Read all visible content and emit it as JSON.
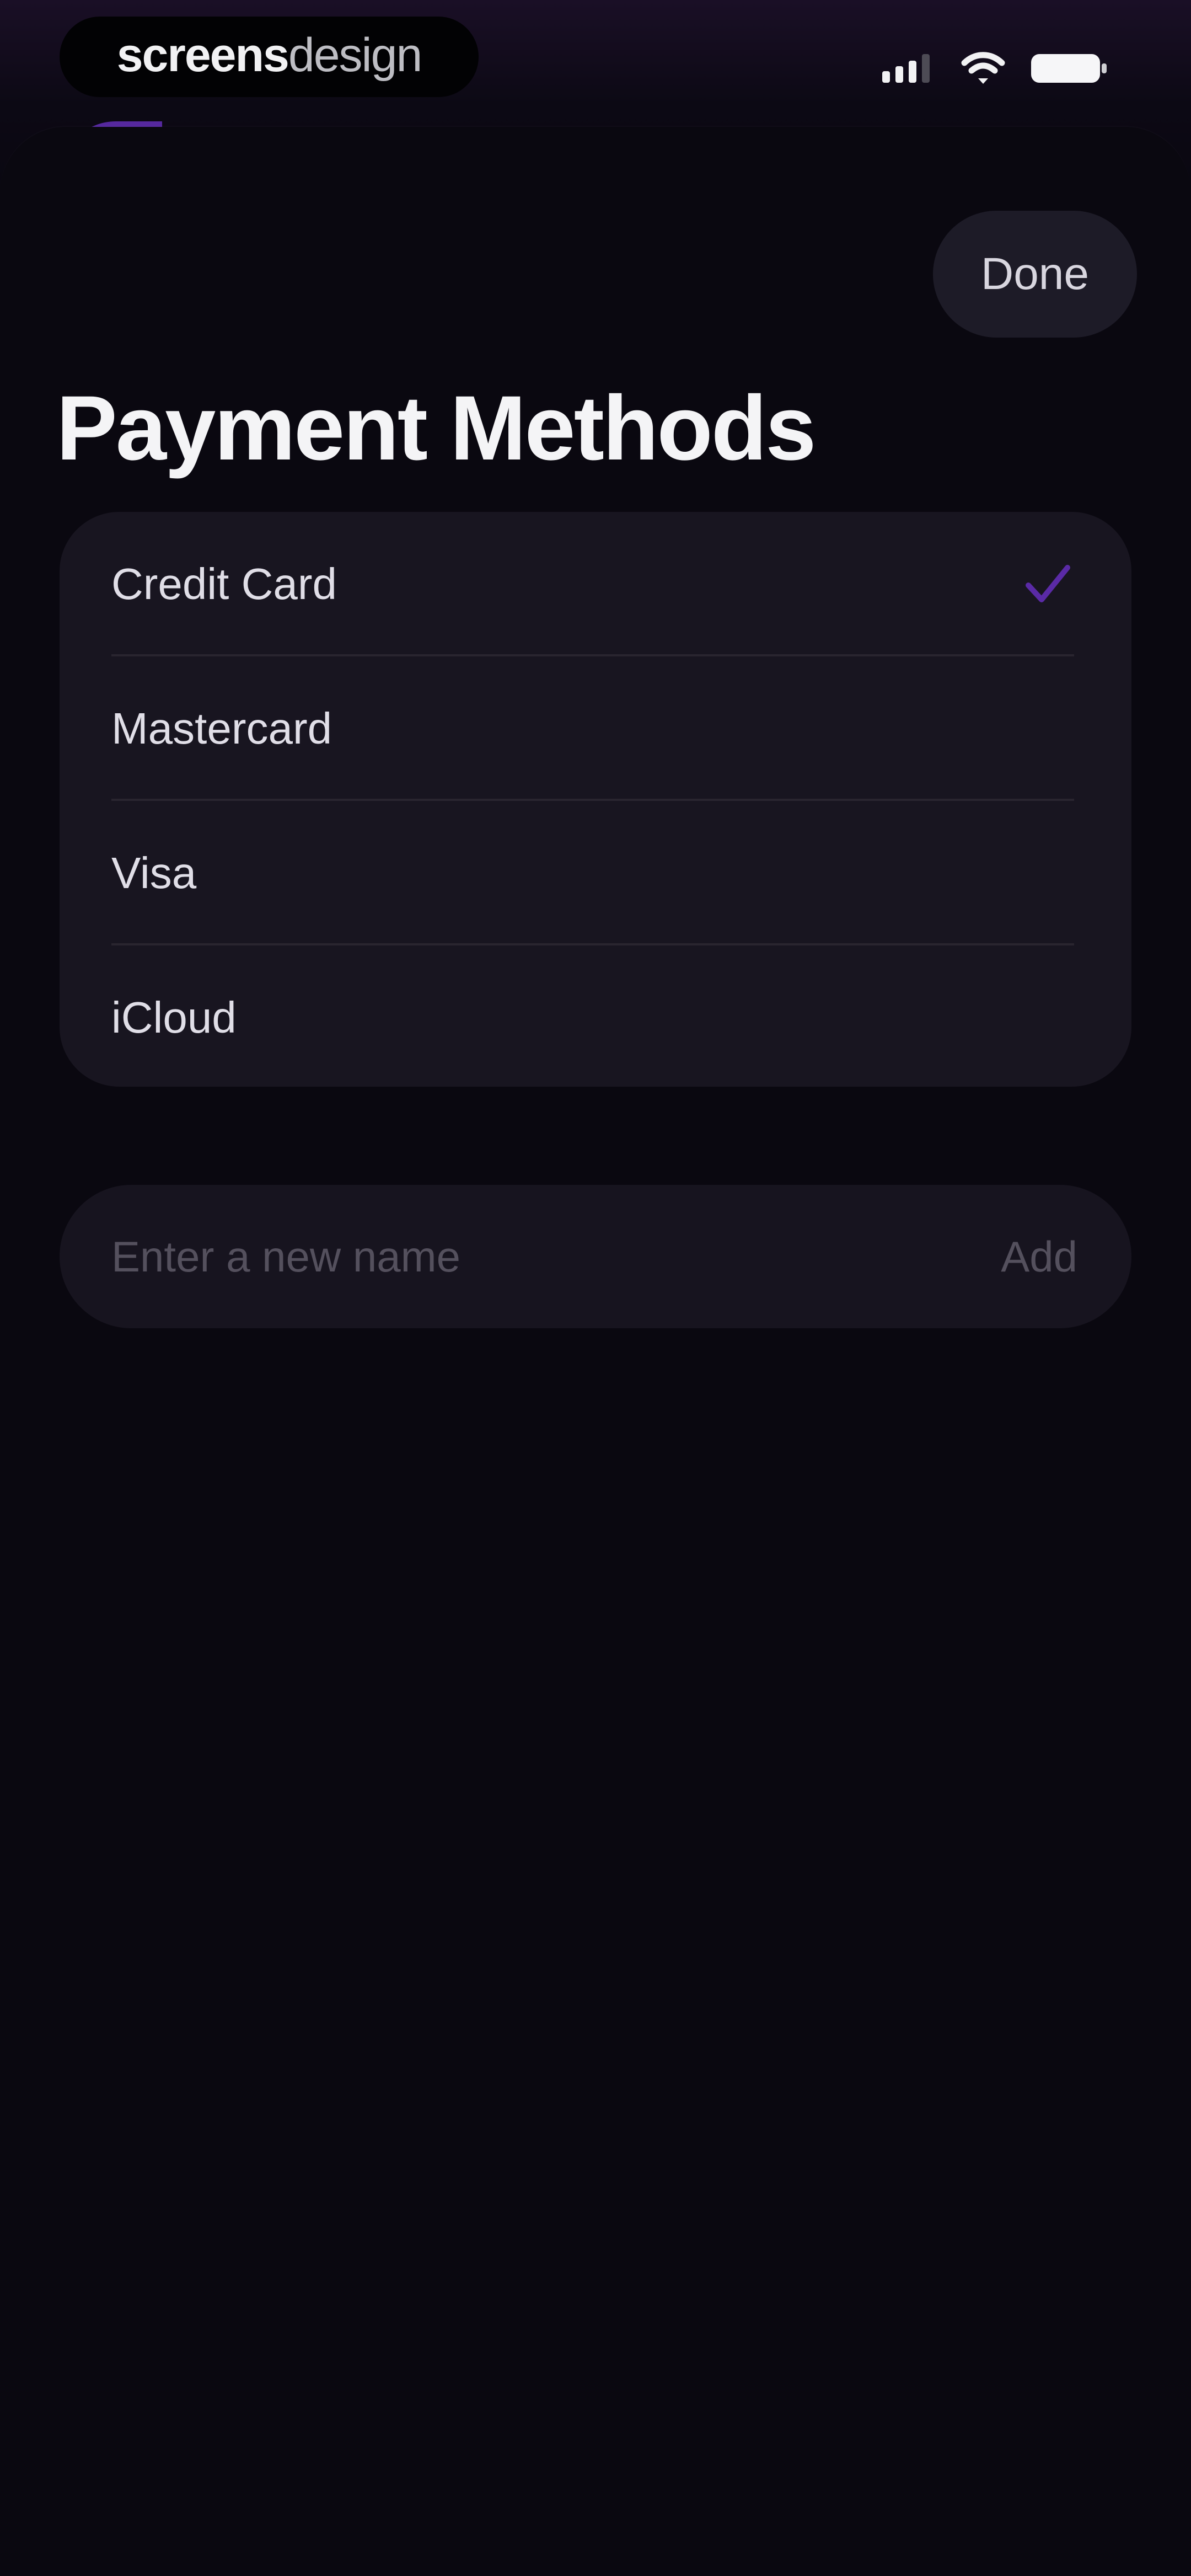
{
  "status_bar": {
    "brand_primary": "screens",
    "brand_secondary": "design",
    "signal_icon": "signal-icon",
    "wifi_icon": "wifi-icon",
    "battery_icon": "battery-icon"
  },
  "header": {
    "done_label": "Done",
    "title": "Payment Methods"
  },
  "payment_methods": {
    "items": [
      {
        "label": "Credit Card",
        "selected": true
      },
      {
        "label": "Mastercard",
        "selected": false
      },
      {
        "label": "Visa",
        "selected": false
      },
      {
        "label": "iCloud",
        "selected": false
      }
    ],
    "selected_icon": "checkmark-icon"
  },
  "new_method": {
    "placeholder": "Enter a new name",
    "add_label": "Add"
  },
  "colors": {
    "background": "#09060f",
    "sheet": "#0a0810",
    "card": "#181520",
    "accent": "#5a2aa6",
    "text_primary": "#f4f4f6",
    "text_secondary": "#54505d"
  }
}
